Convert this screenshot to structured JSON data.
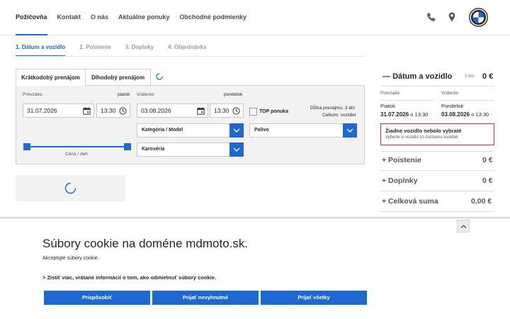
{
  "nav": {
    "items": [
      "Požičovňa",
      "Kontakt",
      "O nás",
      "Aktuálne ponuky",
      "Obchodné podmienky"
    ],
    "icons": [
      "phone-icon",
      "location-pin-icon"
    ],
    "logo": "brand-roundel-logo"
  },
  "steps": [
    "1. Dátum a vozidlo",
    "2. Poistenie",
    "3. Doplnky",
    "4. Objednávka"
  ],
  "tabs": {
    "short": "Krátkodobý prenájom",
    "long": "Dlhodobý prenájom"
  },
  "form": {
    "pickup": {
      "label": "Prevzatie:",
      "day": "piatok",
      "date": "31.07.2026",
      "time": "13:30"
    },
    "return": {
      "label": "Vrátenie:",
      "day": "pondelok",
      "date": "03.08.2026",
      "time": "13:30"
    },
    "top_offer_label": "TOP ponuka",
    "duration": "Dĺžka prenájmu: 3 dni",
    "total": "Celkom: vozidiel",
    "category_select": "Kategória / Model",
    "fuel_select": "Palivo",
    "body_select": "Karoséria",
    "slider_label": "Cena / deň"
  },
  "summary": {
    "title": "Dátum a vozidlo",
    "days": "3 dni",
    "price": "0 €",
    "pickup_label": "Prevzatie",
    "return_label": "Vrátenie",
    "pickup_day": "Piatok",
    "return_day": "Pondelok",
    "pickup_date": "31.07.2026",
    "return_date": "03.08.2026",
    "time_prefix": "o 13:30",
    "warning_title": "Žiadne vozidlo nebolo vybraté",
    "warning_text": "Vyberte si vozidlo zo zoznamu vozidiel.",
    "rows": [
      {
        "label": "+ Poistenie",
        "value": "0 €"
      },
      {
        "label": "+ Doplnky",
        "value": "0 €"
      },
      {
        "label": "+ Celková suma",
        "value": "0,00 €"
      }
    ]
  },
  "cookie": {
    "title": "Súbory cookie na doméne mdmoto.sk.",
    "subtitle": "Akceptujte súbory cookie.",
    "link": "> Zistiť viac, vrátane informácií o tom, ako odmietnuť súbory cookie.",
    "buttons": [
      "Prispôsobiť",
      "Prijať nevyhnutné",
      "Prijať všetky"
    ]
  },
  "colors": {
    "accent": "#1c69d4",
    "warning": "#d0312d"
  }
}
